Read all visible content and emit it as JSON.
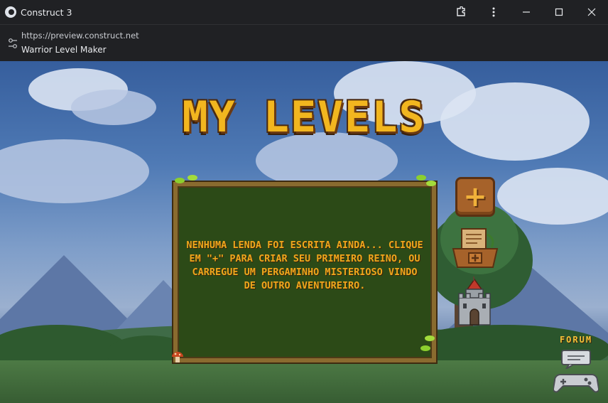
{
  "window": {
    "title": "Construct 3",
    "url": "https://preview.construct.net",
    "page_name": "Warrior Level Maker"
  },
  "game": {
    "title": "MY LEVELS",
    "empty_message": "NENHUMA LENDA FOI ESCRITA AINDA... CLIQUE EM \"+\" PARA CRIAR SEU PRIMEIRO REINO, OU CARREGUE UM PERGAMINHO MISTERIOSO VINDO DE OUTRO AVENTUREIRO.",
    "create_button_symbol": "+",
    "forum_label": "FORUM",
    "icons": [
      "plus-icon",
      "scroll-load-icon",
      "castle-icon",
      "chat-bubble-icon",
      "gamepad-icon",
      "mushroom-icon"
    ]
  }
}
